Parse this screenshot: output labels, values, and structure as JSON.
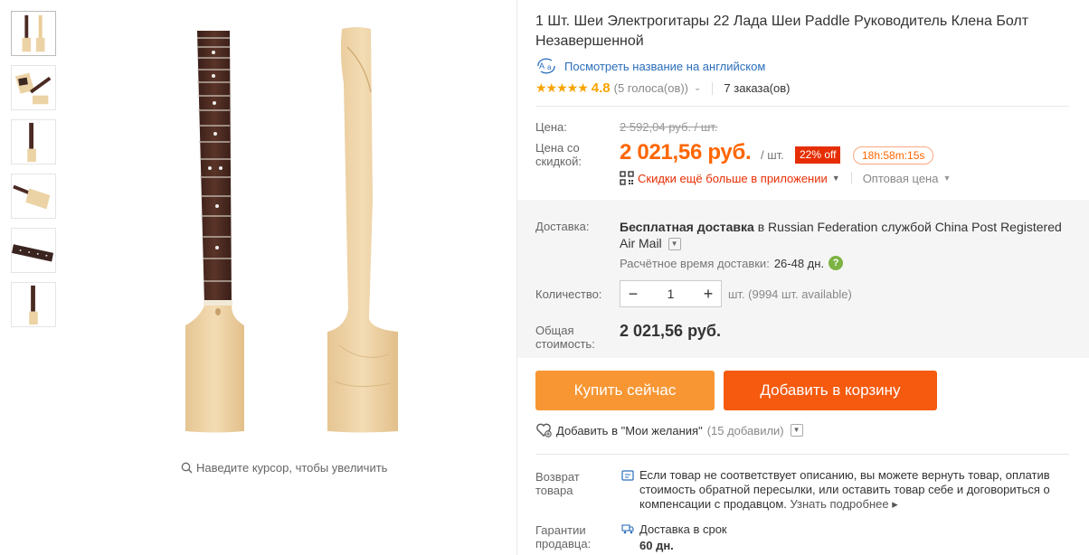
{
  "product": {
    "title": "1 Шт. Шеи Электрогитары 22 Лада Шеи Paddle Руководитель Клена Болт Незавершенной",
    "translate_link": "Посмотреть название на английском",
    "rating": "4.8",
    "votes": "(5 голоса(ов))",
    "orders": "7 заказа(ов)"
  },
  "gallery": {
    "zoom_hint": "Наведите курсор, чтобы увеличить"
  },
  "price": {
    "label": "Цена:",
    "old": "2 592,04 руб. / шт.",
    "discount_label": "Цена со скидкой:",
    "current": "2 021,56 руб.",
    "per_unit": "/ шт.",
    "discount_badge": "22% off",
    "timer": "18h:58m:15s",
    "app_promo": "Скидки ещё больше в приложении",
    "wholesale": "Оптовая цена"
  },
  "shipping": {
    "label": "Доставка:",
    "text_bold": "Бесплатная доставка",
    "text_rest": " в Russian Federation службой China Post Registered Air Mail",
    "eta_label": "Расчётное время доставки:",
    "eta_value": "26-48 дн."
  },
  "quantity": {
    "label": "Количество:",
    "value": "1",
    "minus": "−",
    "plus": "+",
    "available": "шт. (9994 шт. available)"
  },
  "total": {
    "label": "Общая стоимость:",
    "value": "2 021,56 руб."
  },
  "actions": {
    "buy_now": "Купить сейчас",
    "add_to_cart": "Добавить в корзину",
    "wishlist": "Добавить в \"Мои желания\"",
    "wishlist_count": "(15 добавили)"
  },
  "returns": {
    "label": "Возврат товара",
    "text": "Если товар не соответствует описанию, вы можете вернуть товар, оплатив стоимость обратной пересылки, или оставить товар себе и договориться о компенсации с продавцом.",
    "link": "Узнать подробнее"
  },
  "guarantee": {
    "label": "Гарантии продавца:",
    "text": "Доставка в срок",
    "days": "60 дн."
  },
  "colors": {
    "orange_price": "#ff6600",
    "buy_button": "#f79633",
    "cart_button": "#f55a0f",
    "badge_red": "#e62e04",
    "link_blue": "#2a6ebb",
    "star": "#f9a300"
  }
}
